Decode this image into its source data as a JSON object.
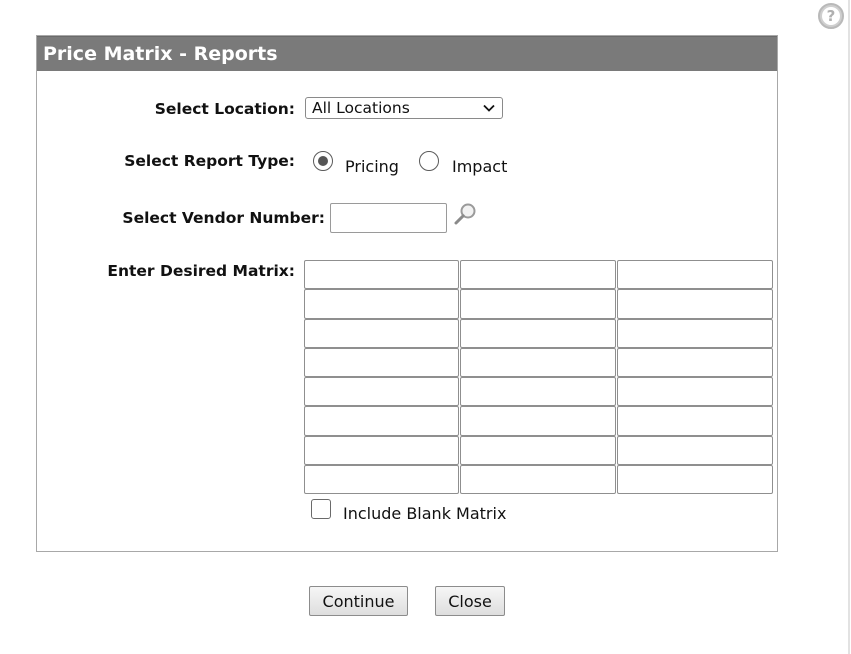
{
  "dialog": {
    "title": "Price Matrix - Reports"
  },
  "location": {
    "label": "Select Location:",
    "selected": "All Locations",
    "chevron_icon": "chevron-down-icon"
  },
  "report_type": {
    "label": "Select Report Type:",
    "options": [
      {
        "label": "Pricing",
        "checked": true
      },
      {
        "label": "Impact",
        "checked": false
      }
    ]
  },
  "vendor": {
    "label": "Select Vendor Number:",
    "value": "",
    "lookup_icon": "magnifier-icon"
  },
  "matrix": {
    "label": "Enter Desired Matrix:",
    "rows": 8,
    "columns": 3,
    "values": [
      [
        "",
        "",
        ""
      ],
      [
        "",
        "",
        ""
      ],
      [
        "",
        "",
        ""
      ],
      [
        "",
        "",
        ""
      ],
      [
        "",
        "",
        ""
      ],
      [
        "",
        "",
        ""
      ],
      [
        "",
        "",
        ""
      ],
      [
        "",
        "",
        ""
      ]
    ]
  },
  "include_blank": {
    "label": "Include Blank Matrix",
    "checked": false
  },
  "buttons": {
    "continue": "Continue",
    "close": "Close"
  },
  "help": {
    "icon": "help-icon",
    "glyph": "?"
  },
  "colors": {
    "header_bg": "#7a7a7a",
    "header_text": "#ffffff",
    "panel_border": "#a8a8a8"
  }
}
